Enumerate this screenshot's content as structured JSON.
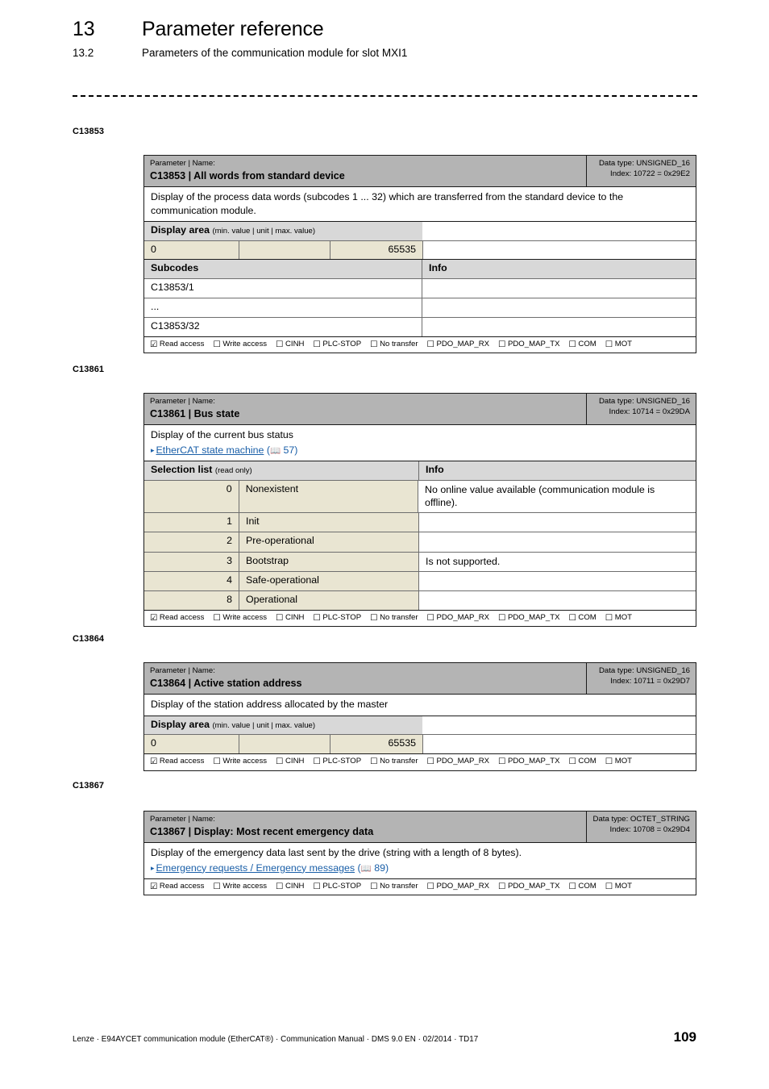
{
  "header": {
    "chapter_number": "13",
    "chapter_title": "Parameter reference",
    "section_number": "13.2",
    "section_title": "Parameters of the communication module for slot MXI1"
  },
  "access_flags": [
    {
      "label": "Read access",
      "checked": true,
      "box": "☑"
    },
    {
      "label": "Write access",
      "checked": false,
      "box": "☐"
    },
    {
      "label": "CINH",
      "checked": false,
      "box": "☐"
    },
    {
      "label": "PLC-STOP",
      "checked": false,
      "box": "☐"
    },
    {
      "label": "No transfer",
      "checked": false,
      "box": "☐"
    },
    {
      "label": "PDO_MAP_RX",
      "checked": false,
      "box": "☐"
    },
    {
      "label": "PDO_MAP_TX",
      "checked": false,
      "box": "☐"
    },
    {
      "label": "COM",
      "checked": false,
      "box": "☐"
    },
    {
      "label": "MOT",
      "checked": false,
      "box": "☐"
    }
  ],
  "labels": {
    "parameter_name_caption": "Parameter | Name:",
    "display_area_title": "Display area",
    "display_area_hint": "(min. value | unit | max. value)",
    "selection_list_title": "Selection list",
    "selection_list_hint": "(read only)",
    "subcodes_title": "Subcodes",
    "info_title": "Info"
  },
  "params": [
    {
      "margin": "C13853",
      "code": "C13853",
      "name": "All words from standard device",
      "title": "C13853 | All words from standard device",
      "datatype": "Data type: UNSIGNED_16",
      "index": "Index: 10722 = 0x29E2",
      "description": "Display of the process data words (subcodes 1 ... 32) which are transferred from the standard device to the communication module.",
      "display_area": {
        "min": "0",
        "unit": "",
        "max": "65535"
      },
      "subcodes": [
        {
          "code": "C13853/1",
          "info": ""
        },
        {
          "code": "...",
          "info": ""
        },
        {
          "code": "C13853/32",
          "info": ""
        }
      ]
    },
    {
      "margin": "C13861",
      "code": "C13861",
      "name": "Bus state",
      "title": "C13861 | Bus state",
      "datatype": "Data type: UNSIGNED_16",
      "index": "Index: 10714 = 0x29DA",
      "description": "Display of the current bus status",
      "link": {
        "text": "EtherCAT state machine",
        "page": "57",
        "bullet": "▸",
        "book_icon": "book-icon"
      },
      "selection_list": [
        {
          "value": "0",
          "label": "Nonexistent",
          "info": "No online value available (communication module is offline)."
        },
        {
          "value": "1",
          "label": "Init",
          "info": ""
        },
        {
          "value": "2",
          "label": "Pre-operational",
          "info": ""
        },
        {
          "value": "3",
          "label": "Bootstrap",
          "info": "Is not supported."
        },
        {
          "value": "4",
          "label": "Safe-operational",
          "info": ""
        },
        {
          "value": "8",
          "label": "Operational",
          "info": ""
        }
      ]
    },
    {
      "margin": "C13864",
      "code": "C13864",
      "name": "Active station address",
      "title": "C13864 | Active station address",
      "datatype": "Data type: UNSIGNED_16",
      "index": "Index: 10711 = 0x29D7",
      "description": "Display of the station address allocated by the master",
      "display_area": {
        "min": "0",
        "unit": "",
        "max": "65535"
      }
    },
    {
      "margin": "C13867",
      "code": "C13867",
      "name": "Display: Most recent emergency data",
      "title": "C13867 | Display: Most recent emergency data",
      "datatype": "Data type: OCTET_STRING",
      "index": "Index: 10708 = 0x29D4",
      "description": "Display of the emergency data last sent by the drive (string with a length of 8 bytes).",
      "link": {
        "text": "Emergency requests / Emergency messages",
        "page": "89",
        "bullet": "▸",
        "book_icon": "book-icon"
      }
    }
  ],
  "footer": {
    "text": "Lenze · E94AYCET communication module (EtherCAT®) · Communication Manual · DMS 9.0 EN · 02/2014 · TD17",
    "page_number": "109"
  },
  "colors": {
    "header_gray": "#b4b4b4",
    "section_gray": "#d8d8d8",
    "value_beige": "#e9e5d2",
    "link_blue": "#1a5fa8",
    "border_dark": "#1a1a1a",
    "border_light": "#6e6e6e"
  }
}
